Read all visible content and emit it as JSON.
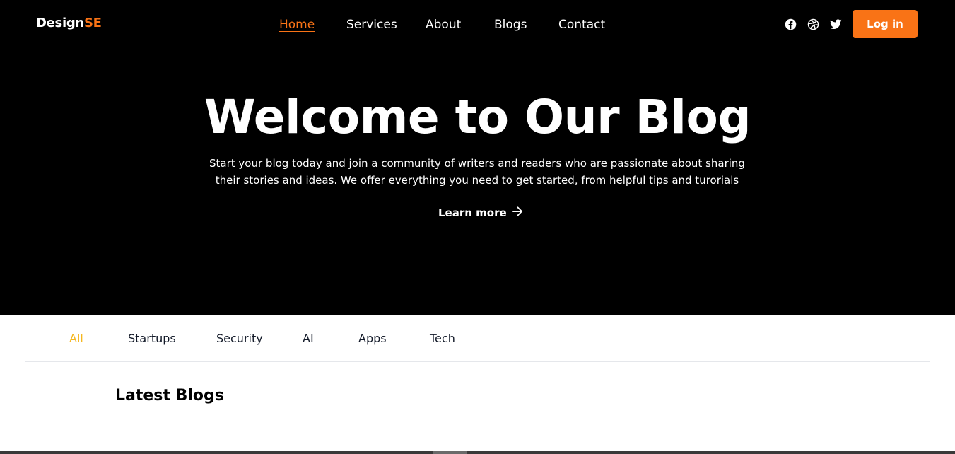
{
  "brand": {
    "name_main": "Design",
    "name_accent": "SE",
    "accent_color": "#f97316"
  },
  "nav": {
    "items": [
      {
        "label": "Home",
        "active": true
      },
      {
        "label": "Services",
        "active": false
      },
      {
        "label": "About",
        "active": false
      },
      {
        "label": "Blogs",
        "active": false
      },
      {
        "label": "Contact",
        "active": false
      }
    ]
  },
  "social": {
    "icons": [
      "facebook-icon",
      "dribbble-icon",
      "twitter-icon"
    ]
  },
  "header": {
    "login_label": "Log in"
  },
  "hero": {
    "title": "Welcome to Our Blog",
    "subtitle": "Start your blog today and join a community of writers and readers who are passionate about sharing their stories and ideas. We offer everything you need to get started, from helpful tips and turorials",
    "cta_label": "Learn more",
    "cta_icon": "arrow-right-icon"
  },
  "categories": {
    "items": [
      {
        "label": "All",
        "active": true
      },
      {
        "label": "Startups",
        "active": false
      },
      {
        "label": "Security",
        "active": false
      },
      {
        "label": "AI",
        "active": false
      },
      {
        "label": "Apps",
        "active": false
      },
      {
        "label": "Tech",
        "active": false
      }
    ],
    "active_color": "#f5b71f"
  },
  "latest": {
    "title": "Latest Blogs"
  }
}
